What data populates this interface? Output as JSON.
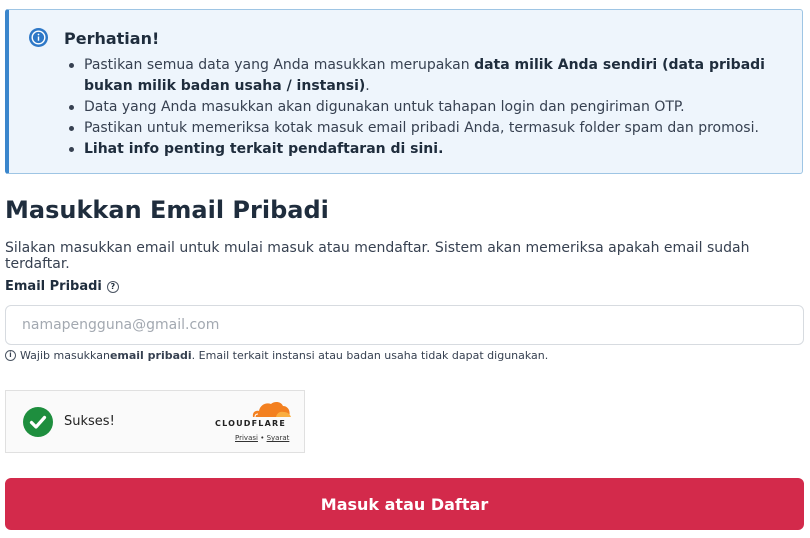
{
  "alert": {
    "title": "Perhatian!",
    "items": [
      {
        "pre": "Pastikan semua data yang Anda masukkan merupakan ",
        "bold": "data milik Anda sendiri (data pribadi bukan milik badan usaha / instansi)",
        "post": "."
      },
      {
        "text": "Data yang Anda masukkan akan digunakan untuk tahapan login dan pengiriman OTP."
      },
      {
        "text": "Pastikan untuk memeriksa kotak masuk email pribadi Anda, termasuk folder spam dan promosi."
      },
      {
        "bold": "Lihat info penting terkait pendaftaran ",
        "link": "di sini",
        "post": "."
      }
    ]
  },
  "form": {
    "heading": "Masukkan Email Pribadi",
    "subtext": "Silakan masukkan email untuk mulai masuk atau mendaftar. Sistem akan memeriksa apakah email sudah terdaftar.",
    "email_label": "Email Pribadi",
    "email_placeholder": "namapengguna@gmail.com",
    "email_value": "",
    "hint": {
      "pre": "Wajib masukkan ",
      "bold": "email pribadi",
      "post": ". Email terkait instansi atau badan usaha tidak dapat digunakan."
    },
    "submit_label": "Masuk atau Daftar"
  },
  "captcha": {
    "status": "Sukses!",
    "brand": "CLOUDFLARE",
    "privacy": "Privasi",
    "separator": "•",
    "terms": "Syarat"
  },
  "colors": {
    "alert_bg": "#eef5fc",
    "alert_border": "#3a86cc",
    "submit_bg": "#d32a4b",
    "success": "#1e8e3e",
    "cloudflare_orange": "#f38020"
  }
}
